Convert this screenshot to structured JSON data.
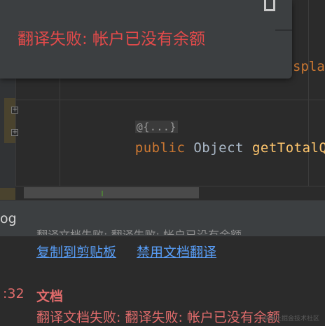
{
  "toast": {
    "message": "翻译失败: 帐户已没有余额",
    "restore_icon": "window-restore-icon"
  },
  "editor": {
    "peek_text": "spla",
    "folded_placeholder": "@{...}",
    "line_keyword": "public",
    "line_type": "Object",
    "line_method": "getTotalQ",
    "fold_icon": "fold-expand-icon"
  },
  "log": {
    "title": "og",
    "partial_line": "翻译文档失败: 翻译失败: 帐户已没有余额",
    "links": {
      "copy": "复制到剪贴板",
      "disable": "禁用文档翻译"
    },
    "entry": {
      "time": ":32",
      "title": "文档",
      "message": "翻译文档失败: 翻译失败: 帐户已没有余额"
    }
  },
  "watermark": "@稀土掘金技术社区",
  "colors": {
    "error": "#e24a4a",
    "link": "#589df6",
    "keyword": "#cc7832",
    "method": "#ffc66d"
  }
}
